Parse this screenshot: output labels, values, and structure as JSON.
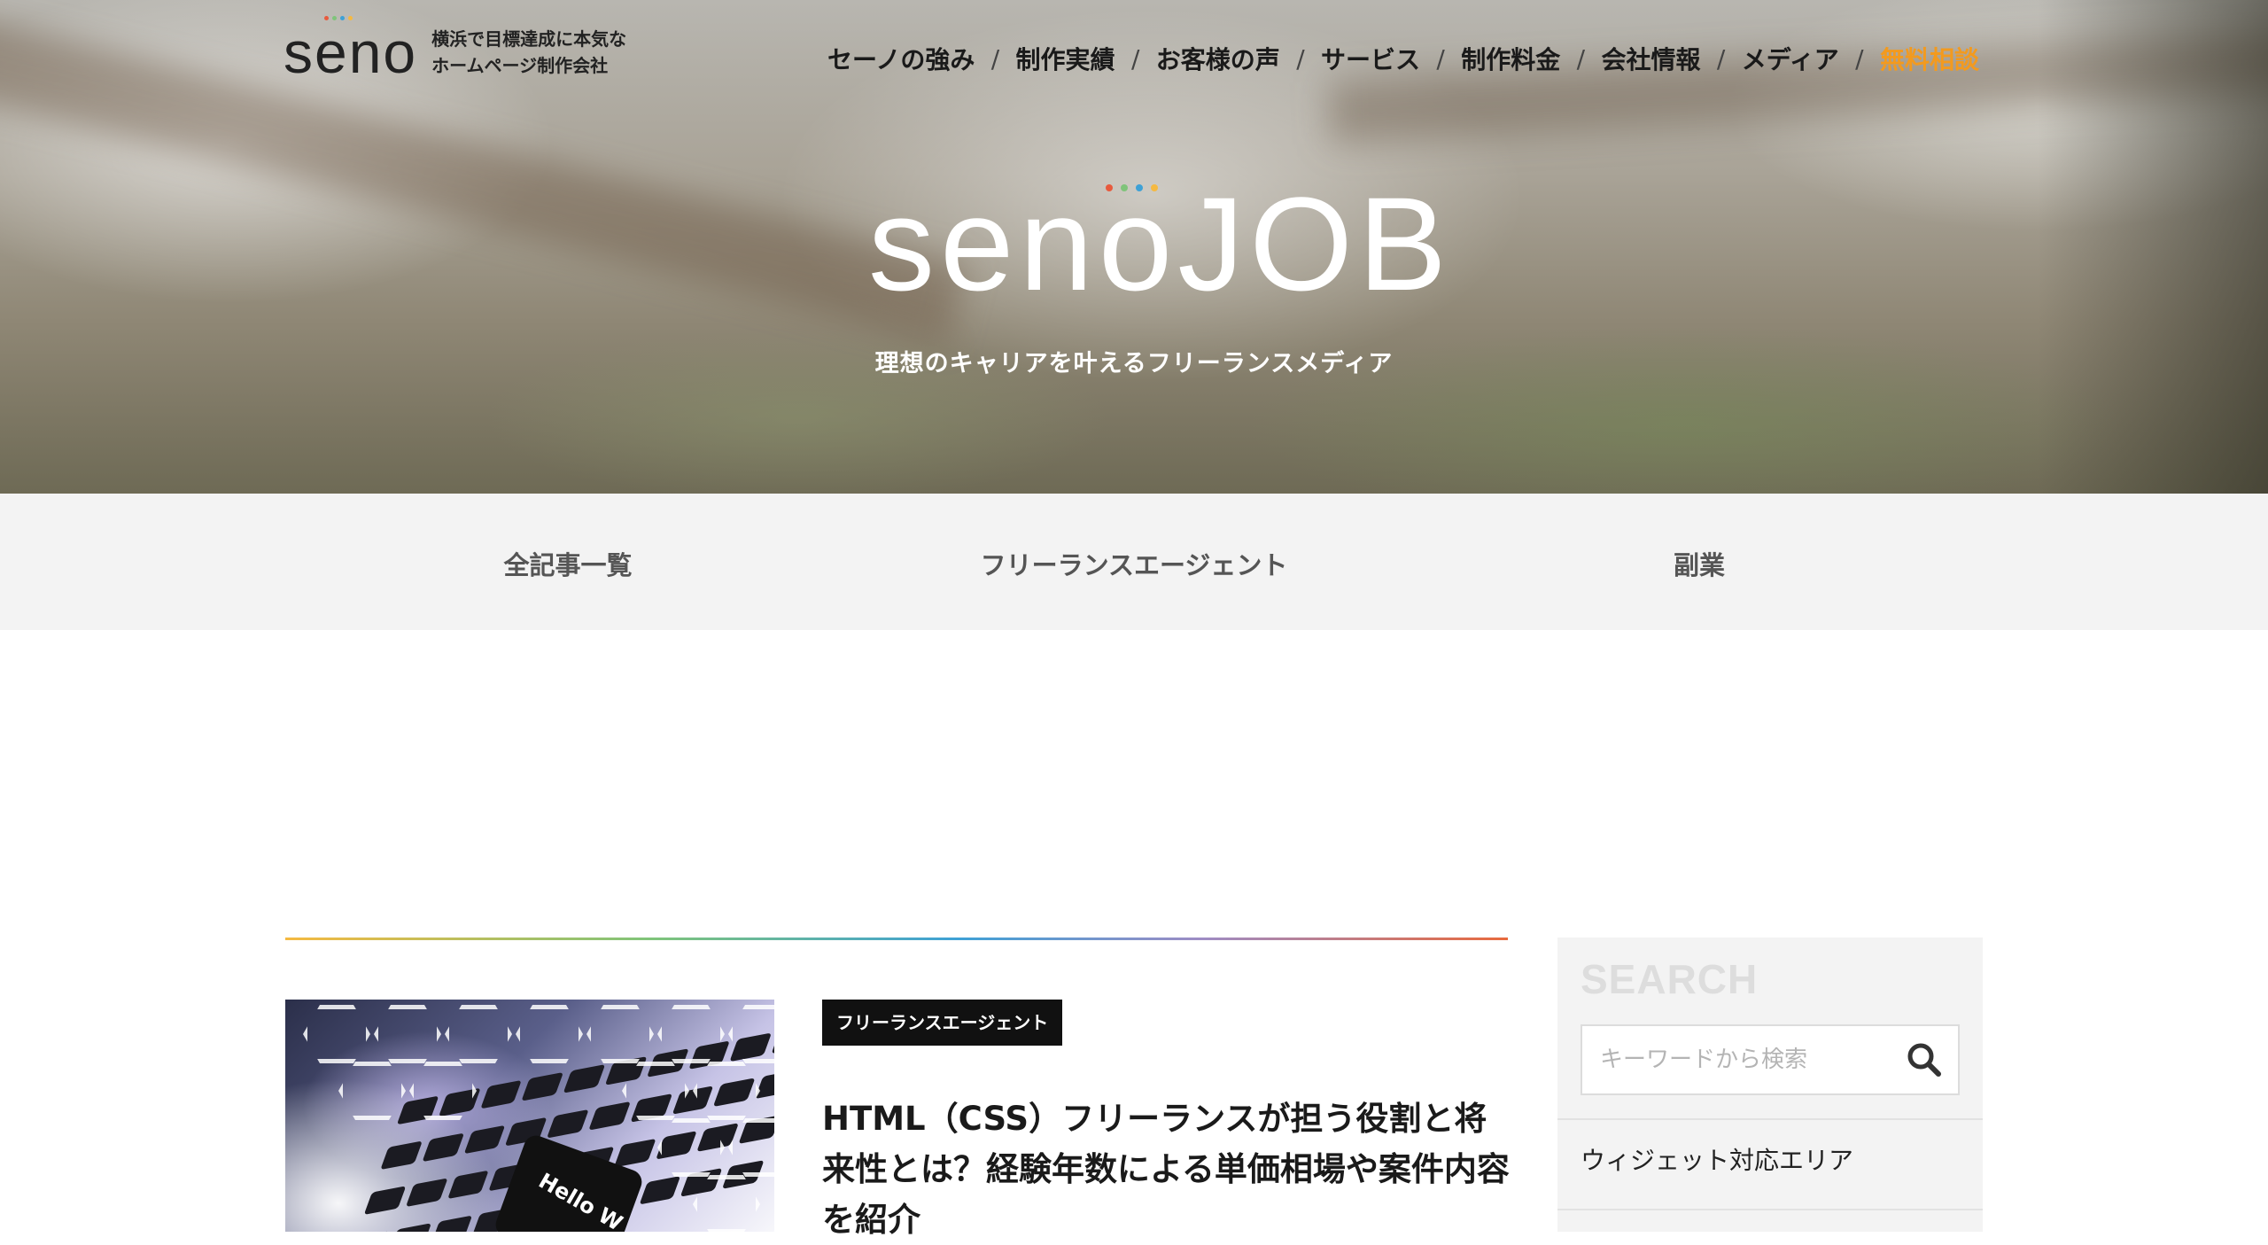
{
  "header": {
    "logo_text": "seno",
    "tagline_line1": "横浜で目標達成に本気な",
    "tagline_line2": "ホームページ制作会社",
    "nav": [
      {
        "label": "セーノの強み"
      },
      {
        "label": "制作実績"
      },
      {
        "label": "お客様の声"
      },
      {
        "label": "サービス"
      },
      {
        "label": "制作料金"
      },
      {
        "label": "会社情報"
      },
      {
        "label": "メディア"
      },
      {
        "label": "無料相談"
      }
    ],
    "separator": "/",
    "cta_color": "#f39a1e"
  },
  "hero": {
    "logo_text": "senoJOB",
    "subtitle": "理想のキャリアを叶えるフリーランスメディア",
    "dot_colors": [
      "#e85a3d",
      "#7fc47a",
      "#3ea1d6",
      "#f5b941"
    ]
  },
  "categories": [
    {
      "label": "全記事一覧"
    },
    {
      "label": "フリーランスエージェント"
    },
    {
      "label": "副業"
    }
  ],
  "article": {
    "tag": "フリーランスエージェント",
    "title": "HTML（CSS）フリーランスが担う役割と将来性とは？経験年数による単価相場や案件内容を紹介",
    "thumbnail_text": "Hello W"
  },
  "sidebar": {
    "search_title": "SEARCH",
    "search_placeholder": "キーワードから検索",
    "search_icon": "search-icon",
    "widget_text": "ウィジェット対応エリア"
  }
}
